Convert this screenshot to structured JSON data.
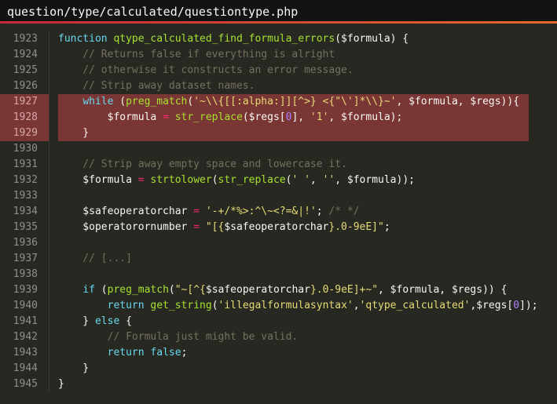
{
  "window": {
    "title": "question/type/calculated/questiontype.php"
  },
  "editor": {
    "highlighted_lines": [
      "1927",
      "1928",
      "1929"
    ],
    "lines": [
      {
        "num": "1923",
        "tokens": [
          {
            "t": "function",
            "c": "kw"
          },
          {
            "t": " ",
            "c": "pl"
          },
          {
            "t": "qtype_calculated_find_formula_errors",
            "c": "fn"
          },
          {
            "t": "($formula) {",
            "c": "pl"
          }
        ]
      },
      {
        "num": "1924",
        "tokens": [
          {
            "t": "    // Returns false if everything is alright",
            "c": "cm"
          }
        ]
      },
      {
        "num": "1925",
        "tokens": [
          {
            "t": "    // otherwise it constructs an error message.",
            "c": "cm"
          }
        ]
      },
      {
        "num": "1926",
        "tokens": [
          {
            "t": "    // Strip away dataset names.",
            "c": "cm"
          }
        ]
      },
      {
        "num": "1927",
        "tokens": [
          {
            "t": "    ",
            "c": "pl"
          },
          {
            "t": "while",
            "c": "kw"
          },
          {
            "t": " (",
            "c": "pl"
          },
          {
            "t": "preg_match",
            "c": "fn"
          },
          {
            "t": "(",
            "c": "pl"
          },
          {
            "t": "'~\\\\{[[:alpha:]][^>} <{\"\\']*\\\\}~'",
            "c": "str"
          },
          {
            "t": ", $formula, $regs)){",
            "c": "pl"
          }
        ]
      },
      {
        "num": "1928",
        "tokens": [
          {
            "t": "        $formula ",
            "c": "pl"
          },
          {
            "t": "=",
            "c": "op"
          },
          {
            "t": " ",
            "c": "pl"
          },
          {
            "t": "str_replace",
            "c": "fn"
          },
          {
            "t": "($regs[",
            "c": "pl"
          },
          {
            "t": "0",
            "c": "num"
          },
          {
            "t": "], ",
            "c": "pl"
          },
          {
            "t": "'1'",
            "c": "str"
          },
          {
            "t": ", $formula);",
            "c": "pl"
          }
        ]
      },
      {
        "num": "1929",
        "tokens": [
          {
            "t": "    }",
            "c": "pl"
          }
        ]
      },
      {
        "num": "1930",
        "tokens": []
      },
      {
        "num": "1931",
        "tokens": [
          {
            "t": "    // Strip away empty space and lowercase it.",
            "c": "cm"
          }
        ]
      },
      {
        "num": "1932",
        "tokens": [
          {
            "t": "    $formula ",
            "c": "pl"
          },
          {
            "t": "=",
            "c": "op"
          },
          {
            "t": " ",
            "c": "pl"
          },
          {
            "t": "strtolower",
            "c": "fn"
          },
          {
            "t": "(",
            "c": "pl"
          },
          {
            "t": "str_replace",
            "c": "fn"
          },
          {
            "t": "(",
            "c": "pl"
          },
          {
            "t": "' '",
            "c": "str"
          },
          {
            "t": ", ",
            "c": "pl"
          },
          {
            "t": "''",
            "c": "str"
          },
          {
            "t": ", $formula));",
            "c": "pl"
          }
        ]
      },
      {
        "num": "1933",
        "tokens": []
      },
      {
        "num": "1934",
        "tokens": [
          {
            "t": "    $safeoperatorchar ",
            "c": "pl"
          },
          {
            "t": "=",
            "c": "op"
          },
          {
            "t": " ",
            "c": "pl"
          },
          {
            "t": "'-+/*%>:^\\~<?=&|!'",
            "c": "str"
          },
          {
            "t": "; ",
            "c": "pl"
          },
          {
            "t": "/* */",
            "c": "cm"
          }
        ]
      },
      {
        "num": "1935",
        "tokens": [
          {
            "t": "    $operatorornumber ",
            "c": "pl"
          },
          {
            "t": "=",
            "c": "op"
          },
          {
            "t": " ",
            "c": "pl"
          },
          {
            "t": "\"[{",
            "c": "str"
          },
          {
            "t": "$safeoperatorchar",
            "c": "pl"
          },
          {
            "t": "}.0-9eE]\"",
            "c": "str"
          },
          {
            "t": ";",
            "c": "pl"
          }
        ]
      },
      {
        "num": "1936",
        "tokens": []
      },
      {
        "num": "1937",
        "tokens": [
          {
            "t": "    // [...]",
            "c": "cm"
          }
        ]
      },
      {
        "num": "1938",
        "tokens": []
      },
      {
        "num": "1939",
        "tokens": [
          {
            "t": "    ",
            "c": "pl"
          },
          {
            "t": "if",
            "c": "kw"
          },
          {
            "t": " (",
            "c": "pl"
          },
          {
            "t": "preg_match",
            "c": "fn"
          },
          {
            "t": "(",
            "c": "pl"
          },
          {
            "t": "\"~[^{",
            "c": "str"
          },
          {
            "t": "$safeoperatorchar",
            "c": "pl"
          },
          {
            "t": "}.0-9eE]+~\"",
            "c": "str"
          },
          {
            "t": ", $formula, $regs)) {",
            "c": "pl"
          }
        ]
      },
      {
        "num": "1940",
        "tokens": [
          {
            "t": "        ",
            "c": "pl"
          },
          {
            "t": "return",
            "c": "kw"
          },
          {
            "t": " ",
            "c": "pl"
          },
          {
            "t": "get_string",
            "c": "fn"
          },
          {
            "t": "(",
            "c": "pl"
          },
          {
            "t": "'illegalformulasyntax'",
            "c": "str"
          },
          {
            "t": ",",
            "c": "pl"
          },
          {
            "t": "'qtype_calculated'",
            "c": "str"
          },
          {
            "t": ",$regs[",
            "c": "pl"
          },
          {
            "t": "0",
            "c": "num"
          },
          {
            "t": "]);",
            "c": "pl"
          }
        ]
      },
      {
        "num": "1941",
        "tokens": [
          {
            "t": "    } ",
            "c": "pl"
          },
          {
            "t": "else",
            "c": "kw"
          },
          {
            "t": " {",
            "c": "pl"
          }
        ]
      },
      {
        "num": "1942",
        "tokens": [
          {
            "t": "        // Formula just might be valid.",
            "c": "cm"
          }
        ]
      },
      {
        "num": "1943",
        "tokens": [
          {
            "t": "        ",
            "c": "pl"
          },
          {
            "t": "return",
            "c": "kw"
          },
          {
            "t": " ",
            "c": "pl"
          },
          {
            "t": "false",
            "c": "kw"
          },
          {
            "t": ";",
            "c": "pl"
          }
        ]
      },
      {
        "num": "1944",
        "tokens": [
          {
            "t": "    }",
            "c": "pl"
          }
        ]
      },
      {
        "num": "1945",
        "tokens": [
          {
            "t": "}",
            "c": "pl"
          }
        ]
      }
    ]
  },
  "colors": {
    "background": "#272822",
    "titlebar": "#131313",
    "highlight": "#7a3535",
    "keyword": "#66d9ef",
    "function": "#a6e22e",
    "string": "#e6db74",
    "number": "#ae81ff",
    "operator": "#f92672",
    "comment": "#75715e"
  }
}
